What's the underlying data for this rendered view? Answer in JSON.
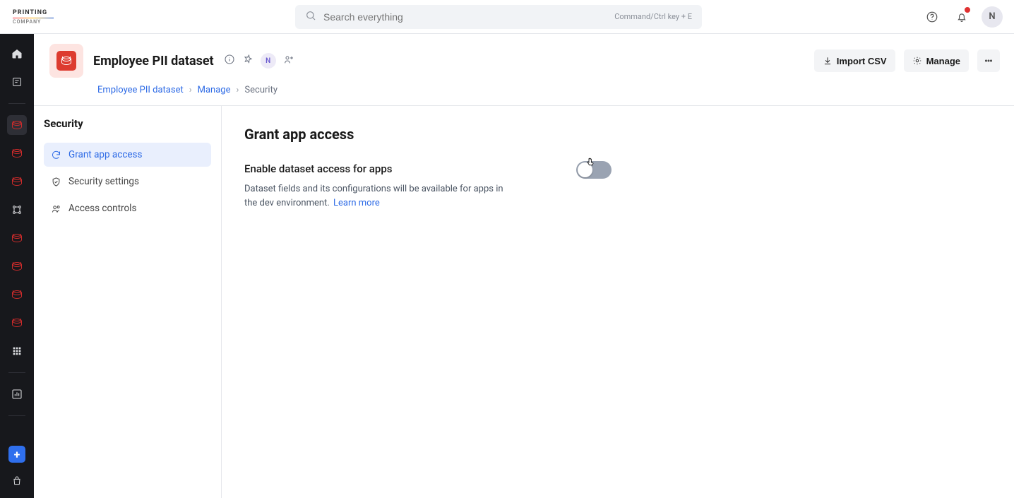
{
  "brand": {
    "name": "PRINTING",
    "sub": "COMPANY"
  },
  "search": {
    "placeholder": "Search everything",
    "shortcut": "Command/Ctrl key + E"
  },
  "topbar": {
    "avatar_letter": "N"
  },
  "page": {
    "title": "Employee PII dataset",
    "owner_letter": "N",
    "actions": {
      "import_csv": "Import CSV",
      "manage": "Manage"
    }
  },
  "breadcrumb": {
    "items": [
      {
        "label": "Employee PII dataset",
        "link": true
      },
      {
        "label": "Manage",
        "link": true
      },
      {
        "label": "Security",
        "link": false
      }
    ]
  },
  "sidebar": {
    "title": "Security",
    "items": [
      {
        "label": "Grant app access"
      },
      {
        "label": "Security settings"
      },
      {
        "label": "Access controls"
      }
    ]
  },
  "main": {
    "title": "Grant app access",
    "setting": {
      "label": "Enable dataset access for apps",
      "description": "Dataset fields and its configurations will be available for apps in the dev environment.",
      "learn_more": "Learn more",
      "enabled": false
    }
  }
}
